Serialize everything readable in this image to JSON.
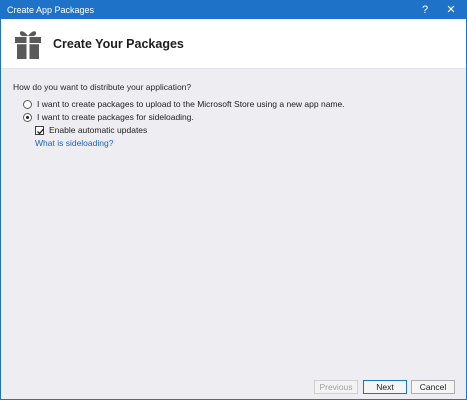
{
  "window": {
    "title": "Create App Packages",
    "help_label": "?",
    "close_label": "✕"
  },
  "header": {
    "title": "Create Your Packages",
    "icon": "gift-package-icon"
  },
  "content": {
    "question": "How do you want to distribute your application?",
    "options": [
      {
        "label": "I want to create packages to upload to the Microsoft Store using a new app name.",
        "selected": false
      },
      {
        "label": "I want to create packages for sideloading.",
        "selected": true
      }
    ],
    "checkbox": {
      "label": "Enable automatic updates",
      "checked": true
    },
    "link": "What is sideloading?"
  },
  "footer": {
    "previous_label": "Previous",
    "next_label": "Next",
    "cancel_label": "Cancel"
  },
  "colors": {
    "accent": "#1e73c9",
    "link": "#1a62b8",
    "background": "#eeeef2"
  }
}
